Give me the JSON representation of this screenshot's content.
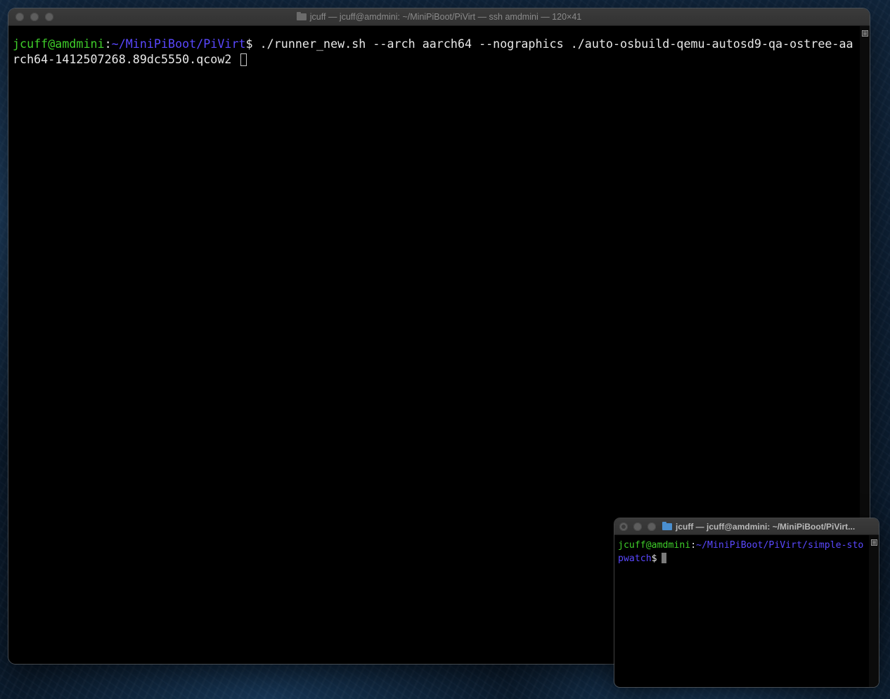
{
  "main_window": {
    "title": "jcuff — jcuff@amdmini: ~/MiniPiBoot/PiVirt — ssh amdmini — 120×41",
    "title_icon": "folder-icon",
    "prompt_user": "jcuff@amdmini",
    "prompt_sep": ":",
    "prompt_path": "~/MiniPiBoot/PiVirt",
    "prompt_symbol": "$",
    "command": " ./runner_new.sh --arch aarch64 --nographics ./auto-osbuild-qemu-autosd9-qa-ostree-aarch64-1412507268.89dc5550.qcow2 "
  },
  "small_window": {
    "title": "jcuff — jcuff@amdmini: ~/MiniPiBoot/PiVirt...",
    "title_icon": "folder-icon",
    "prompt_user": "jcuff@amdmini",
    "prompt_sep": ":",
    "prompt_path": "~/MiniPiBoot/PiVirt/simple-stopwatch",
    "prompt_symbol": "$"
  },
  "colors": {
    "username": "#3fce2a",
    "path": "#5a48ff",
    "text": "#e8e8e8",
    "terminal_bg": "#000000"
  }
}
